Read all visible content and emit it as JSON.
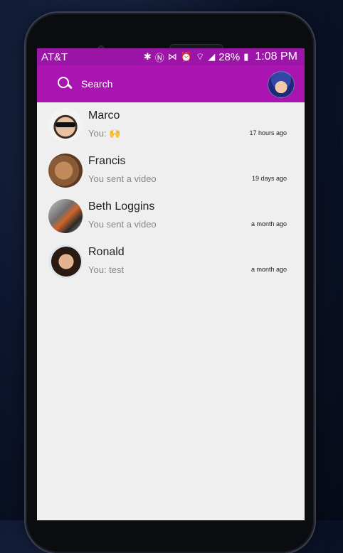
{
  "status_bar": {
    "carrier": "AT&T",
    "icons": [
      "bluetooth-icon",
      "nfc-icon",
      "vibrate-icon",
      "alarm-icon",
      "wifi-icon",
      "signal-icon",
      "battery-icon"
    ],
    "battery": "28%",
    "time": "1:08 PM"
  },
  "header": {
    "search_label": "Search",
    "accent_color": "#aa14b0"
  },
  "conversations": [
    {
      "name": "Marco",
      "preview": "You: 🙌",
      "time": "17 hours ago"
    },
    {
      "name": "Francis",
      "preview": "You sent a video",
      "time": "19 days ago"
    },
    {
      "name": "Beth Loggins",
      "preview": "You sent a video",
      "time": "a month ago"
    },
    {
      "name": "Ronald",
      "preview": "You: test",
      "time": "a month ago"
    }
  ]
}
